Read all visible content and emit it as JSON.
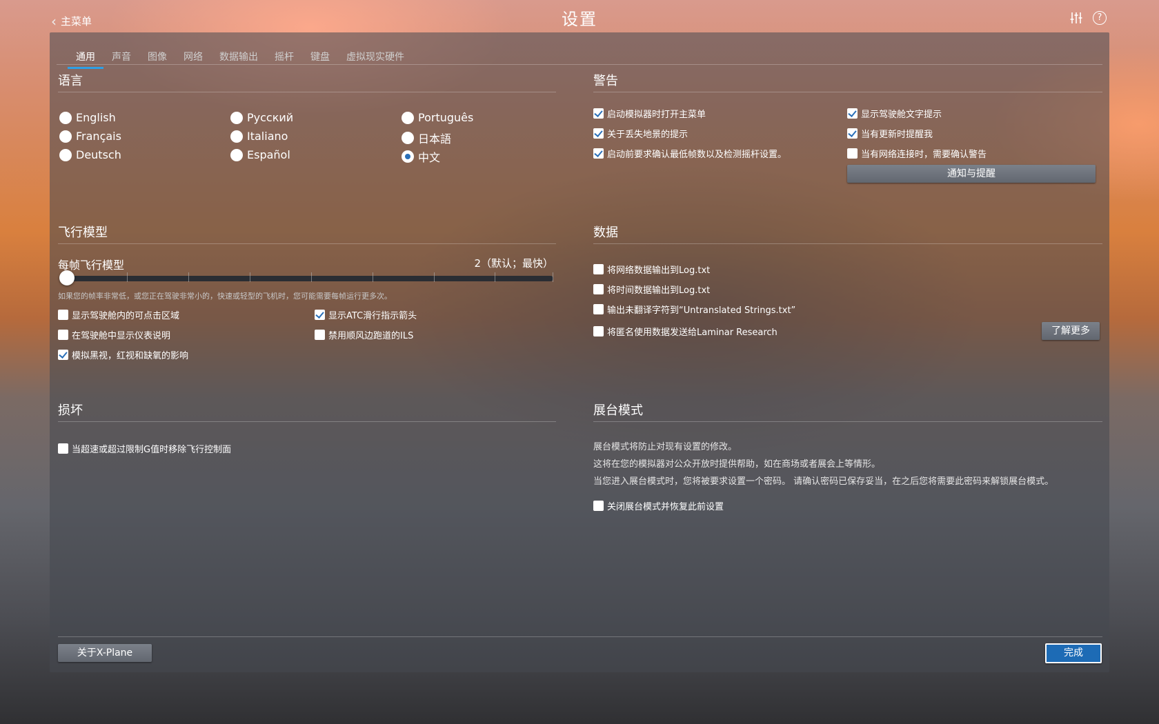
{
  "topbar": {
    "back_label": "主菜单",
    "title": "设置",
    "icons": [
      "sliders-icon",
      "help-icon"
    ]
  },
  "tabs": [
    "通用",
    "声音",
    "图像",
    "网络",
    "数据输出",
    "摇杆",
    "键盘",
    "虚拟现实硬件"
  ],
  "active_tab": "通用",
  "language": {
    "title": "语言",
    "options": [
      "English",
      "Français",
      "Deutsch",
      "Русский",
      "Italiano",
      "Español",
      "Português",
      "日本語",
      "中文"
    ],
    "selected": "中文"
  },
  "warnings": {
    "title": "警告",
    "items": [
      {
        "label": "启动模拟器时打开主菜单",
        "checked": true
      },
      {
        "label": "关于丢失地景的提示",
        "checked": true
      },
      {
        "label": "启动前要求确认最低帧数以及检测摇杆设置。",
        "checked": true
      },
      {
        "label": "显示驾驶舱文字提示",
        "checked": true
      },
      {
        "label": "当有更新时提醒我",
        "checked": true
      },
      {
        "label": "当有网络连接时，需要确认警告",
        "checked": false
      }
    ],
    "notify_button": "通知与提醒"
  },
  "flight_model": {
    "title": "飞行模型",
    "slider_label": "每帧飞行模型",
    "slider_value": "2（默认；最快）",
    "slider_level": 0,
    "hint": "如果您的帧率非常低，或您正在驾驶非常小的，快速或轻型的飞机时，您可能需要每帧运行更多次。",
    "items": [
      {
        "label": "显示驾驶舱内的可点击区域",
        "checked": false
      },
      {
        "label": "在驾驶舱中显示仪表说明",
        "checked": false
      },
      {
        "label": "模拟黑视，红视和缺氧的影响",
        "checked": true
      },
      {
        "label": "显示ATC滑行指示箭头",
        "checked": true
      },
      {
        "label": "禁用顺风边跑道的ILS",
        "checked": false
      }
    ]
  },
  "data": {
    "title": "数据",
    "items": [
      {
        "label": "将网络数据输出到Log.txt",
        "checked": false
      },
      {
        "label": "将时间数据输出到Log.txt",
        "checked": false
      },
      {
        "label": "输出未翻译字符到“Untranslated Strings.txt”",
        "checked": false
      },
      {
        "label": "将匿名使用数据发送给Laminar Research",
        "checked": false
      }
    ],
    "learn_more": "了解更多"
  },
  "damage": {
    "title": "损坏",
    "items": [
      {
        "label": "当超速或超过限制G值时移除飞行控制面",
        "checked": false
      }
    ]
  },
  "kiosk": {
    "title": "展台模式",
    "lines": [
      "展台模式将防止对现有设置的修改。",
      "这将在您的模拟器对公众开放时提供帮助，如在商场或者展会上等情形。",
      "当您进入展台模式时，您将被要求设置一个密码。 请确认密码已保存妥当，在之后您将需要此密码来解锁展台模式。"
    ],
    "checkbox": {
      "label": "关闭展台模式并恢复此前设置",
      "checked": false
    }
  },
  "footer": {
    "about_button": "关于X-Plane",
    "done_button": "完成"
  }
}
